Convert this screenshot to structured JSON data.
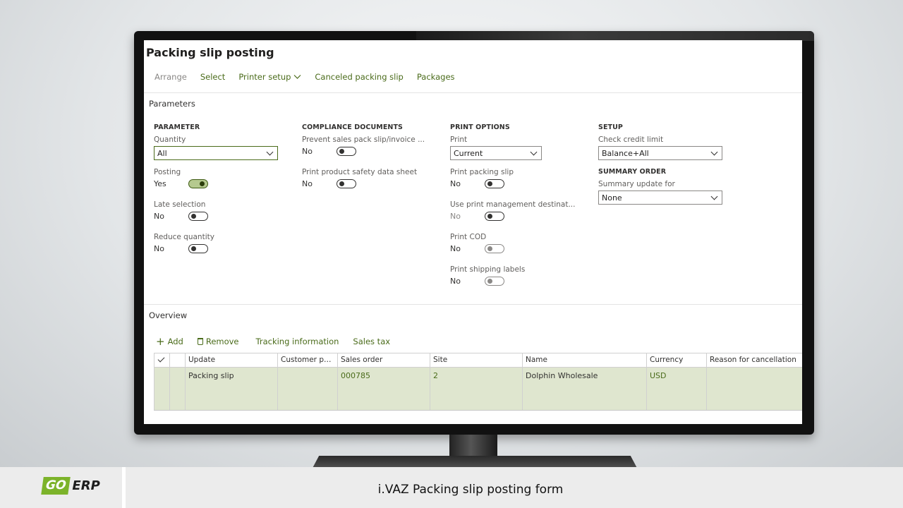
{
  "page": {
    "title": "Packing slip posting",
    "toolbar": [
      {
        "label": "Arrange",
        "disabled": true
      },
      {
        "label": "Select",
        "disabled": false
      },
      {
        "label": "Printer setup",
        "disabled": false
      },
      {
        "label": "Canceled packing slip",
        "disabled": false
      },
      {
        "label": "Packages",
        "disabled": false
      }
    ]
  },
  "parameters": {
    "section_title": "Parameters",
    "parameter": {
      "heading": "PARAMETER",
      "quantity_label": "Quantity",
      "quantity_value": "All",
      "posting_label": "Posting",
      "posting_value": "Yes",
      "late_selection_label": "Late selection",
      "late_selection_value": "No",
      "reduce_quantity_label": "Reduce quantity",
      "reduce_quantity_value": "No"
    },
    "compliance": {
      "heading": "COMPLIANCE DOCUMENTS",
      "prevent_label": "Prevent sales pack slip/invoice ...",
      "prevent_value": "No",
      "safety_label": "Print product safety data sheet",
      "safety_value": "No"
    },
    "print_options": {
      "heading": "PRINT OPTIONS",
      "print_label": "Print",
      "print_value": "Current",
      "packing_slip_label": "Print packing slip",
      "packing_slip_value": "No",
      "print_mgmt_label": "Use print management destinat...",
      "print_mgmt_value": "No",
      "cod_label": "Print COD",
      "cod_value": "No",
      "shipping_label": "Print shipping labels",
      "shipping_value": "No"
    },
    "setup": {
      "heading": "SETUP",
      "credit_label": "Check credit limit",
      "credit_value": "Balance+All",
      "summary_heading": "SUMMARY ORDER",
      "summary_label": "Summary update for",
      "summary_value": "None"
    }
  },
  "overview": {
    "section_title": "Overview",
    "actions": {
      "add": "Add",
      "remove": "Remove",
      "tracking": "Tracking information",
      "sales_tax": "Sales tax"
    },
    "columns": [
      "Update",
      "Customer pac...",
      "Sales order",
      "Site",
      "Name",
      "Currency",
      "Reason for cancellation"
    ],
    "rows": [
      {
        "update": "Packing slip",
        "customer_pack": "",
        "sales_order": "000785",
        "site": "2",
        "name": "Dolphin Wholesale",
        "currency": "USD",
        "reason": ""
      }
    ]
  },
  "footer": {
    "logo_go": "GO",
    "logo_erp": "ERP",
    "caption": "i.VAZ Packing slip posting form"
  },
  "colors": {
    "accent": "#4a6b1a",
    "selected_row": "#dfe6cf",
    "logo_green": "#7cb32a"
  }
}
